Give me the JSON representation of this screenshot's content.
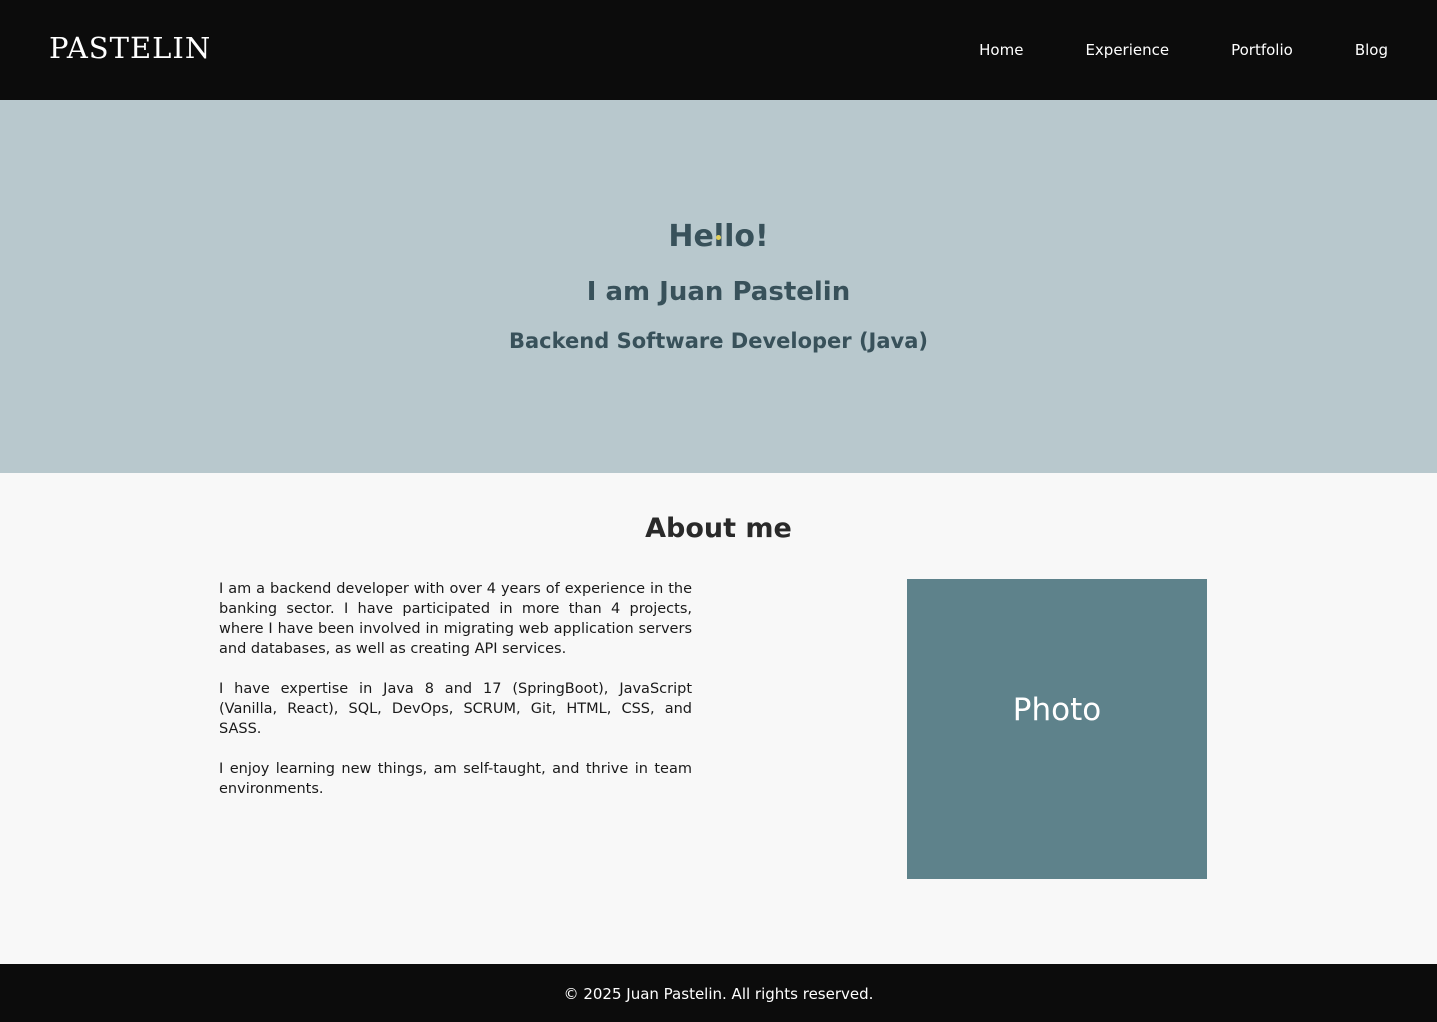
{
  "header": {
    "logo": "PASTELIN",
    "nav": [
      {
        "label": "Home"
      },
      {
        "label": "Experience"
      },
      {
        "label": "Portfolio"
      },
      {
        "label": "Blog"
      }
    ]
  },
  "hero": {
    "greeting": "Hello!",
    "name": "I am Juan Pastelin",
    "role": "Backend Software Developer (Java)"
  },
  "about": {
    "title": "About me",
    "paragraphs": [
      "I am a backend developer with over 4 years of experience in the banking sector. I have participated in more than 4 projects, where I have been involved in migrating web application servers and databases, as well as creating API services.",
      "I have expertise in Java 8 and 17 (SpringBoot), JavaScript (Vanilla, React), SQL, DevOps, SCRUM, Git, HTML, CSS, and SASS.",
      "I enjoy learning new things, am self-taught, and thrive in team environments."
    ],
    "photo_label": "Photo"
  },
  "footer": {
    "copyright": "© 2025 Juan Pastelin. All rights reserved."
  },
  "colors": {
    "header_bg": "#0c0c0c",
    "hero_bg": "#b8c8cd",
    "hero_text": "#38515a",
    "photo_bg": "#5e828b",
    "page_bg": "#f8f8f8"
  }
}
